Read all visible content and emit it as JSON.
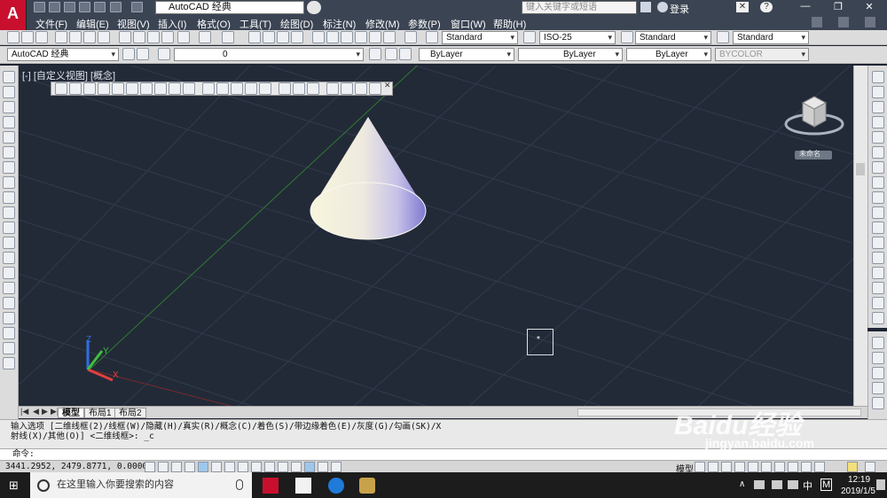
{
  "title_bar": {
    "app_logo": "A",
    "workspace": "AutoCAD 经典",
    "search_placeholder": "键入关键字或短语",
    "login": "登录"
  },
  "menu": [
    "文件(F)",
    "编辑(E)",
    "视图(V)",
    "插入(I)",
    "格式(O)",
    "工具(T)",
    "绘图(D)",
    "标注(N)",
    "修改(M)",
    "参数(P)",
    "窗口(W)",
    "帮助(H)"
  ],
  "styles_toolbar": {
    "text_style": "Standard",
    "dim_style": "ISO-25",
    "table_style": "Standard",
    "multileader_style": "Standard"
  },
  "layers_toolbar": {
    "workspace": "AutoCAD 经典",
    "layer": "0",
    "color": "ByLayer",
    "linetype": "ByLayer",
    "lineweight": "ByLayer",
    "plotstyle": "BYCOLOR"
  },
  "viewport": {
    "label": "[-] [自定义视图] [概念]",
    "viewcube_face": "未命名"
  },
  "tabs": [
    "模型",
    "布局1",
    "布局2"
  ],
  "command": {
    "history_line1": "输入选项 [二维线框(2)/线框(W)/隐藏(H)/真实(R)/概念(C)/着色(S)/带边缘着色(E)/灰度(G)/勾画(SK)/X",
    "history_line2": "射线(X)/其他(O)] <二维线框>: _c",
    "prompt": "命令:"
  },
  "status": {
    "coordinates": "3441.2952,  2479.8771, 0.0000",
    "model_label": "模型"
  },
  "taskbar": {
    "search_placeholder": "在这里输入你要搜索的内容",
    "ime": "中",
    "ime_mode": "M",
    "time": "12:19",
    "date": "2019/1/5"
  },
  "watermark": {
    "brand": "Baidu经验",
    "url": "jingyan.baidu.com"
  },
  "colors": {
    "drawing_bg": "#222a38",
    "title_bar": "#3b4453",
    "toolbar": "#dcdcdc",
    "cone_light": "#f5f2d6",
    "cone_shadow": "#8a85d6"
  }
}
